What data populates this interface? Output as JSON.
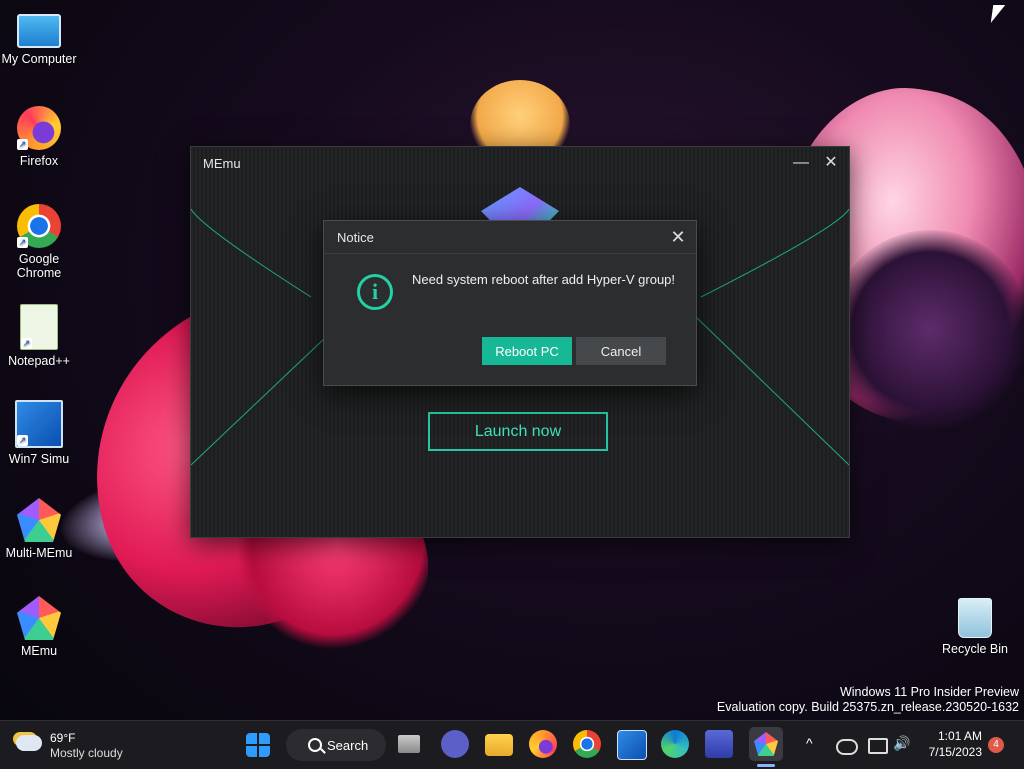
{
  "desktop": {
    "icons": [
      {
        "label": "My Computer"
      },
      {
        "label": "Firefox"
      },
      {
        "label": "Google Chrome"
      },
      {
        "label": "Notepad++"
      },
      {
        "label": "Win7 Simu"
      },
      {
        "label": "Multi-MEmu"
      },
      {
        "label": "MEmu"
      }
    ],
    "recycle_bin": {
      "label": "Recycle Bin"
    }
  },
  "memu_window": {
    "title": "MEmu",
    "minimize_glyph": "—",
    "close_glyph": "✕",
    "launch_label": "Launch now"
  },
  "notice_dialog": {
    "title": "Notice",
    "close_glyph": "✕",
    "message": "Need system reboot after add Hyper-V group!",
    "icon_glyph": "i",
    "primary_button": "Reboot PC",
    "secondary_button": "Cancel"
  },
  "watermark": {
    "line1": "Windows 11 Pro Insider Preview",
    "line2": "Evaluation copy. Build 25375.zn_release.230520-1632"
  },
  "taskbar": {
    "weather": {
      "temp": "69°F",
      "description": "Mostly cloudy"
    },
    "search_label": "Search",
    "pinned": [
      "start-icon",
      "task-view-icon",
      "teams-meet-icon",
      "file-explorer-icon",
      "firefox-icon",
      "chrome-icon",
      "win7-simu-icon",
      "edge-icon",
      "clipchamp-icon",
      "memu-icon"
    ],
    "tray": {
      "chevron_glyph": "^",
      "volume_glyph": "🔊"
    },
    "clock": {
      "time": "1:01 AM",
      "date": "7/15/2023"
    },
    "notification_count": "4"
  },
  "colors": {
    "accent": "#25d0a6",
    "reboot_button": "#17b895",
    "cancel_button": "#45494c"
  }
}
